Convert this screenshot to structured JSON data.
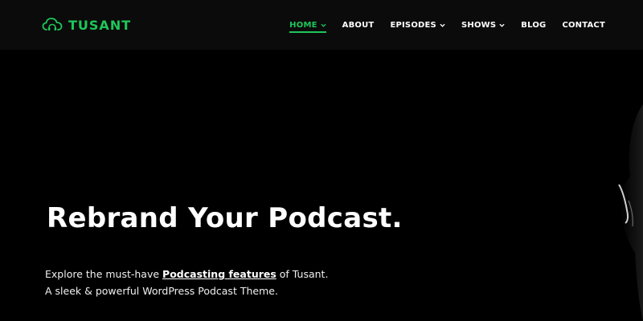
{
  "brand": {
    "name": "TUSANT",
    "icon": "cloud-headphones-icon",
    "accent": "#1ec75a"
  },
  "nav": {
    "items": [
      {
        "label": "HOME",
        "active": true,
        "has_dropdown": true
      },
      {
        "label": "ABOUT",
        "active": false,
        "has_dropdown": false
      },
      {
        "label": "EPISODES",
        "active": false,
        "has_dropdown": true
      },
      {
        "label": "SHOWS",
        "active": false,
        "has_dropdown": true
      },
      {
        "label": "BLOG",
        "active": false,
        "has_dropdown": false
      },
      {
        "label": "CONTACT",
        "active": false,
        "has_dropdown": false
      }
    ]
  },
  "hero": {
    "title": "Rebrand Your Podcast.",
    "line1_prefix": "Explore the must-have ",
    "line1_link": "Podcasting features",
    "line1_suffix": " of Tusant.",
    "line2": "A sleek & powerful WordPress Podcast Theme."
  },
  "colors": {
    "background": "#000000",
    "topbar": "#0b0b0b",
    "text": "#ffffff"
  }
}
